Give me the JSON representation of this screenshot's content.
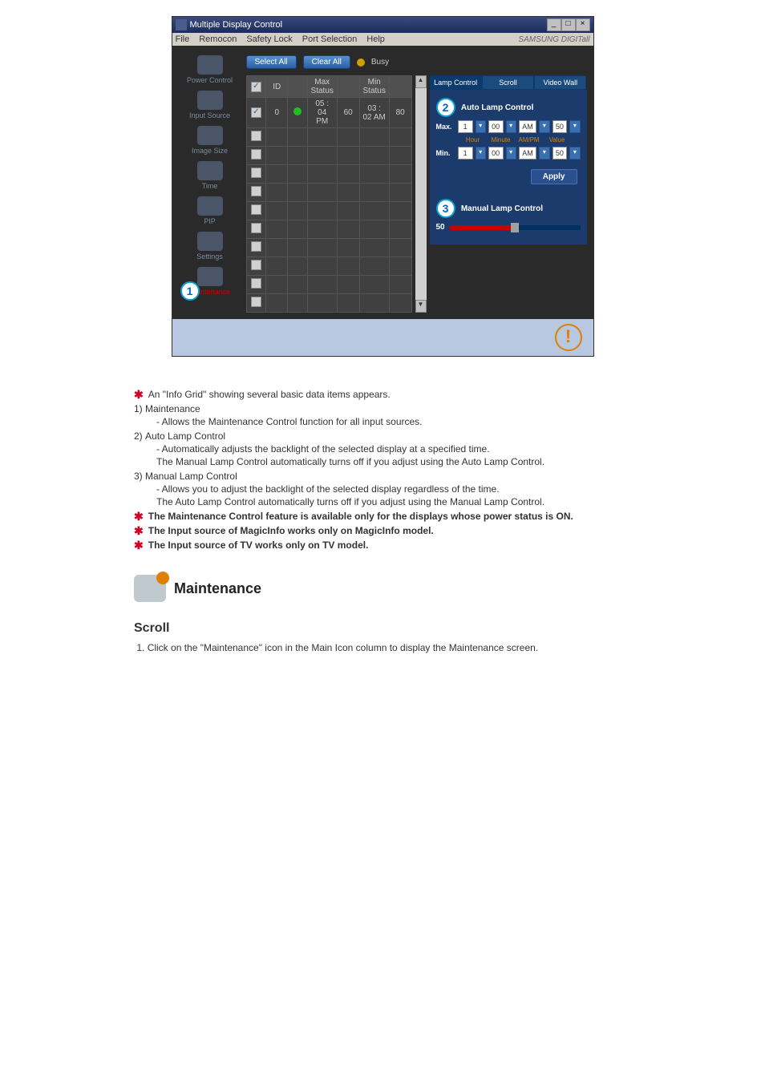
{
  "window": {
    "title": "Multiple Display Control",
    "menu": [
      "File",
      "Remocon",
      "Safety Lock",
      "Port Selection",
      "Help"
    ],
    "brand": "SAMSUNG DIGITall"
  },
  "sidebar": [
    {
      "label": "Power Control"
    },
    {
      "label": "Input Source"
    },
    {
      "label": "Image Size"
    },
    {
      "label": "Time"
    },
    {
      "label": "PIP"
    },
    {
      "label": "Settings"
    },
    {
      "label": "Maintenance"
    }
  ],
  "callouts": {
    "c1": "1",
    "c2": "2",
    "c3": "3"
  },
  "toolbar": {
    "select_all": "Select All",
    "clear_all": "Clear All",
    "busy": "Busy"
  },
  "grid": {
    "headers": [
      "",
      "ID",
      "",
      "Max Status",
      "",
      "Min Status",
      ""
    ],
    "row": {
      "id": "0",
      "max_status": "05 : 04 PM",
      "max_val": "60",
      "min_status": "03 : 02 AM",
      "min_val": "80"
    }
  },
  "tabs": [
    "Lamp Control",
    "Scroll",
    "Video Wall"
  ],
  "auto_lamp": {
    "title": "Auto Lamp Control",
    "col_labels": [
      "Hour",
      "Minute",
      "AM/PM",
      "Value"
    ],
    "max_label": "Max.",
    "min_label": "Min.",
    "max": {
      "hour": "1",
      "minute": "00",
      "ampm": "AM",
      "value": "50"
    },
    "min": {
      "hour": "1",
      "minute": "00",
      "ampm": "AM",
      "value": "50"
    },
    "apply": "Apply"
  },
  "manual_lamp": {
    "title": "Manual Lamp Control",
    "value": "50"
  },
  "status_icon": "!",
  "doc": {
    "intro": "An \"Info Grid\" showing several basic data items appears.",
    "items": [
      {
        "num": "1)",
        "title": "Maintenance",
        "lines": [
          "- Allows the Maintenance Control function for all input sources."
        ]
      },
      {
        "num": "2)",
        "title": "Auto Lamp Control",
        "lines": [
          "- Automatically adjusts the backlight of the selected display at a specified time.",
          "  The Manual Lamp Control automatically turns off if you adjust using the Auto Lamp Control."
        ]
      },
      {
        "num": "3)",
        "title": "Manual Lamp Control",
        "lines": [
          "- Allows you to adjust the backlight of the selected display regardless of the time.",
          "  The Auto Lamp Control automatically turns off if you adjust using the Manual Lamp Control."
        ]
      }
    ],
    "bold_notes": [
      "The Maintenance Control feature is available only for the displays whose power status is ON.",
      "The Input source of MagicInfo works only on MagicInfo model.",
      "The Input source of TV works only on TV model."
    ],
    "section_title": "Maintenance",
    "sub_heading": "Scroll",
    "scroll_step": "Click on the \"Maintenance\" icon in the Main Icon column to display the Maintenance screen."
  }
}
